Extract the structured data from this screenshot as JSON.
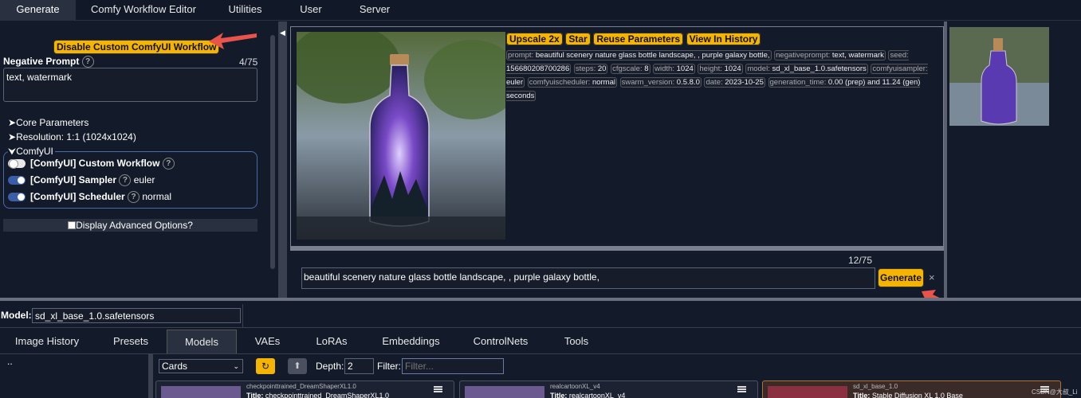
{
  "nav": {
    "tabs": [
      "Generate",
      "Comfy Workflow Editor",
      "Utilities",
      "User",
      "Server"
    ]
  },
  "left": {
    "disable_button": "Disable Custom ComfyUI Workflow",
    "negative_label": "Negative Prompt",
    "negative_count": "4/75",
    "negative_value": "text, watermark",
    "help": "?",
    "core_params": "Core Parameters",
    "resolution": "Resolution: 1:1 (1024x1024)",
    "comfyui_group": "ComfyUI",
    "custom_workflow_label": "[ComfyUI] Custom Workflow",
    "sampler_label": "[ComfyUI] Sampler",
    "sampler_value": "euler",
    "scheduler_label": "[ComfyUI] Scheduler",
    "scheduler_value": "normal",
    "advanced_label": "Display Advanced Options?"
  },
  "center": {
    "buttons": {
      "upscale": "Upscale 2x",
      "star": "Star",
      "reuse": "Reuse Parameters",
      "history": "View In History"
    },
    "meta": {
      "prompt_k": "prompt:",
      "prompt_v": "beautiful scenery nature glass bottle landscape, , purple galaxy bottle,",
      "neg_k": "negativeprompt:",
      "neg_v": "text, watermark",
      "seed_k": "seed:",
      "seed_v": "156680208700286",
      "steps_k": "steps:",
      "steps_v": "20",
      "cfg_k": "cfgscale:",
      "cfg_v": "8",
      "width_k": "width:",
      "width_v": "1024",
      "height_k": "height:",
      "height_v": "1024",
      "model_k": "model:",
      "model_v": "sd_xl_base_1.0.safetensors",
      "sampler_k": "comfyuisampler:",
      "sampler_v": "euler",
      "scheduler_k": "comfyuischeduler:",
      "scheduler_v": "normal",
      "version_k": "swarm_version:",
      "version_v": "0.5.8.0",
      "date_k": "date:",
      "date_v": "2023-10-25",
      "gentime_k": "generation_time:",
      "gentime_v": "0.00 (prep) and 11.24 (gen) seconds"
    },
    "prompt_count": "12/75",
    "prompt_value": "beautiful scenery nature glass bottle landscape, , purple galaxy bottle,",
    "generate_button": "Generate",
    "close": "×"
  },
  "model_bar": {
    "label": "Model:",
    "value": "sd_xl_base_1.0.safetensors"
  },
  "bottom_tabs": [
    "Image History",
    "Presets",
    "Models",
    "VAEs",
    "LoRAs",
    "Embeddings",
    "ControlNets",
    "Tools"
  ],
  "browser": {
    "folder_up": "..",
    "view_select": "Cards",
    "depth_label": "Depth:",
    "depth_value": "2",
    "filter_label": "Filter:",
    "filter_placeholder": "Filter...",
    "cards": [
      {
        "file": "checkpointtrained_DreamShaperXL1.0",
        "title_label": "Title:",
        "title": "checkpointtrained_DreamShaperXL1.0"
      },
      {
        "file": "realcartoonXL_v4",
        "title_label": "Title:",
        "title": "realcartoonXL_v4"
      },
      {
        "file": "sd_xl_base_1.0",
        "title_label": "Title:",
        "title": "Stable Diffusion XL 1.0 Base"
      }
    ],
    "watermark": "CSDN@大叔_Li"
  },
  "icons": {
    "gear": "gear-icon",
    "refresh": "refresh-icon",
    "up": "up-icon",
    "menu": "menu-icon"
  },
  "colors": {
    "accent": "#f4b400",
    "background": "#131a2a",
    "arrow": "#e8534a"
  }
}
